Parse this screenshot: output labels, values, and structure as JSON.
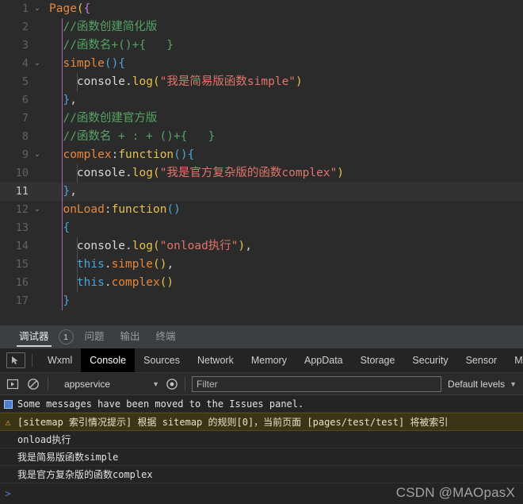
{
  "editor": {
    "lines": [
      {
        "num": "1",
        "fold": "v",
        "indent": 0,
        "current": false,
        "tokens": [
          {
            "t": "Page",
            "c": "t-fn"
          },
          {
            "t": "(",
            "c": "t-b1"
          },
          {
            "t": "{",
            "c": "t-b3"
          }
        ]
      },
      {
        "num": "2",
        "fold": "",
        "indent": 1,
        "current": false,
        "tokens": [
          {
            "t": "//函数创建简化版",
            "c": "t-comment"
          }
        ]
      },
      {
        "num": "3",
        "fold": "",
        "indent": 1,
        "current": false,
        "tokens": [
          {
            "t": "//函数名+()+{   }",
            "c": "t-comment"
          }
        ]
      },
      {
        "num": "4",
        "fold": "v",
        "indent": 1,
        "current": false,
        "tokens": [
          {
            "t": "simple",
            "c": "t-fn"
          },
          {
            "t": "()",
            "c": "t-b2"
          },
          {
            "t": "{",
            "c": "t-b2"
          }
        ]
      },
      {
        "num": "5",
        "fold": "",
        "indent": 2,
        "current": false,
        "tokens": [
          {
            "t": "console",
            "c": "t-plain"
          },
          {
            "t": ".",
            "c": "t-punct"
          },
          {
            "t": "log",
            "c": "t-kw"
          },
          {
            "t": "(",
            "c": "t-b1"
          },
          {
            "t": "\"我是简易版函数simple\"",
            "c": "t-str"
          },
          {
            "t": ")",
            "c": "t-b1"
          }
        ]
      },
      {
        "num": "6",
        "fold": "",
        "indent": 1,
        "current": false,
        "tokens": [
          {
            "t": "}",
            "c": "t-b2"
          },
          {
            "t": ",",
            "c": "t-punct"
          }
        ]
      },
      {
        "num": "7",
        "fold": "",
        "indent": 1,
        "current": false,
        "tokens": [
          {
            "t": "//函数创建官方版",
            "c": "t-comment"
          }
        ]
      },
      {
        "num": "8",
        "fold": "",
        "indent": 1,
        "current": false,
        "tokens": [
          {
            "t": "//函数名 + : + ()+{   }",
            "c": "t-comment"
          }
        ]
      },
      {
        "num": "9",
        "fold": "v",
        "indent": 1,
        "current": false,
        "tokens": [
          {
            "t": "complex",
            "c": "t-fn"
          },
          {
            "t": ":",
            "c": "t-punct"
          },
          {
            "t": "function",
            "c": "t-kw"
          },
          {
            "t": "()",
            "c": "t-b2"
          },
          {
            "t": "{",
            "c": "t-b2"
          }
        ]
      },
      {
        "num": "10",
        "fold": "",
        "indent": 2,
        "current": false,
        "tokens": [
          {
            "t": "console",
            "c": "t-plain"
          },
          {
            "t": ".",
            "c": "t-punct"
          },
          {
            "t": "log",
            "c": "t-kw"
          },
          {
            "t": "(",
            "c": "t-b1"
          },
          {
            "t": "\"我是官方复杂版的函数complex\"",
            "c": "t-str"
          },
          {
            "t": ")",
            "c": "t-b1"
          }
        ]
      },
      {
        "num": "11",
        "fold": "",
        "indent": 1,
        "current": true,
        "tokens": [
          {
            "t": "}",
            "c": "t-b2"
          },
          {
            "t": ",",
            "c": "t-punct"
          }
        ]
      },
      {
        "num": "12",
        "fold": "v",
        "indent": 1,
        "current": false,
        "tokens": [
          {
            "t": "onLoad",
            "c": "t-fn"
          },
          {
            "t": ":",
            "c": "t-punct"
          },
          {
            "t": "function",
            "c": "t-kw"
          },
          {
            "t": "()",
            "c": "t-b2"
          }
        ]
      },
      {
        "num": "13",
        "fold": "",
        "indent": 1,
        "current": false,
        "tokens": [
          {
            "t": "{",
            "c": "t-b2"
          }
        ]
      },
      {
        "num": "14",
        "fold": "",
        "indent": 2,
        "current": false,
        "tokens": [
          {
            "t": "console",
            "c": "t-plain"
          },
          {
            "t": ".",
            "c": "t-punct"
          },
          {
            "t": "log",
            "c": "t-kw"
          },
          {
            "t": "(",
            "c": "t-b1"
          },
          {
            "t": "\"onload执行\"",
            "c": "t-str"
          },
          {
            "t": ")",
            "c": "t-b1"
          },
          {
            "t": ",",
            "c": "t-punct"
          }
        ]
      },
      {
        "num": "15",
        "fold": "",
        "indent": 2,
        "current": false,
        "tokens": [
          {
            "t": "this",
            "c": "t-this"
          },
          {
            "t": ".",
            "c": "t-punct"
          },
          {
            "t": "simple",
            "c": "t-fn"
          },
          {
            "t": "()",
            "c": "t-b1"
          },
          {
            "t": ",",
            "c": "t-punct"
          }
        ]
      },
      {
        "num": "16",
        "fold": "",
        "indent": 2,
        "current": false,
        "tokens": [
          {
            "t": "this",
            "c": "t-this"
          },
          {
            "t": ".",
            "c": "t-punct"
          },
          {
            "t": "complex",
            "c": "t-fn"
          },
          {
            "t": "()",
            "c": "t-b1"
          }
        ]
      },
      {
        "num": "17",
        "fold": "",
        "indent": 1,
        "current": false,
        "tokens": [
          {
            "t": "}",
            "c": "t-b2"
          }
        ]
      }
    ]
  },
  "panel_tabs": {
    "items": [
      {
        "label": "调试器",
        "active": true,
        "badge": "1"
      },
      {
        "label": "问题",
        "active": false,
        "badge": ""
      },
      {
        "label": "输出",
        "active": false,
        "badge": ""
      },
      {
        "label": "终端",
        "active": false,
        "badge": ""
      }
    ]
  },
  "devtools": {
    "tabs": [
      {
        "label": "Wxml",
        "active": false
      },
      {
        "label": "Console",
        "active": true
      },
      {
        "label": "Sources",
        "active": false
      },
      {
        "label": "Network",
        "active": false
      },
      {
        "label": "Memory",
        "active": false
      },
      {
        "label": "AppData",
        "active": false
      },
      {
        "label": "Storage",
        "active": false
      },
      {
        "label": "Security",
        "active": false
      },
      {
        "label": "Sensor",
        "active": false
      },
      {
        "label": "Mo",
        "active": false
      }
    ],
    "toolbar": {
      "context_value": "appservice",
      "filter_placeholder": "Filter",
      "filter_value": "",
      "levels_label": "Default levels"
    },
    "messages": [
      {
        "kind": "info",
        "icon": "message-icon",
        "text": "Some messages have been moved to the Issues panel."
      },
      {
        "kind": "warn",
        "icon": "warning-icon",
        "text": "[sitemap 索引情况提示] 根据 sitemap 的规则[0]，当前页面 [pages/test/test] 将被索引"
      },
      {
        "kind": "log",
        "icon": "",
        "text": "onload执行"
      },
      {
        "kind": "log",
        "icon": "",
        "text": "我是简易版函数simple"
      },
      {
        "kind": "log",
        "icon": "",
        "text": "我是官方复杂版的函数complex"
      }
    ],
    "prompt": ">"
  },
  "watermark": "CSDN @MAOpasX",
  "colors": {
    "editor_bg": "#2b2b2b",
    "current_line_bg": "#323232",
    "comment": "#55a362",
    "string": "#e0756b",
    "identifier": "#e8883a",
    "keyword": "#e6c14e",
    "this_keyword": "#4aa5d8",
    "indent_guide_active": "#9d6fa8",
    "warn_row_bg": "#3b3416",
    "active_tab_bg": "#000000"
  }
}
